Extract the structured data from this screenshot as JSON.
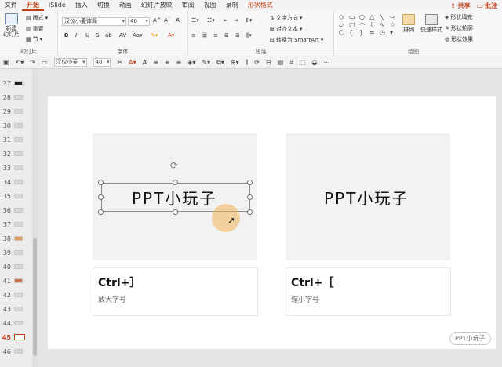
{
  "tabs": [
    "文件",
    "开始",
    "iSlide",
    "插入",
    "切换",
    "动画",
    "幻灯片放映",
    "审阅",
    "视图",
    "录制",
    "形状格式"
  ],
  "active_tab": "开始",
  "share_label": "共享",
  "annotate_label": "批注",
  "ribbon": {
    "slides_group": {
      "new_slide": "新建\n幻灯片",
      "layout": "版式",
      "reset": "重置",
      "section": "节",
      "label": "幻灯片"
    },
    "font_group": {
      "font_name": "汉仪小麦体简",
      "font_size": "40",
      "bold": "B",
      "italic": "I",
      "underline": "U",
      "strike": "S",
      "label": "字体"
    },
    "paragraph_group": {
      "text_direction": "文字方向",
      "align_text": "对齐文本",
      "smartart": "转换为 SmartArt",
      "label": "段落"
    },
    "drawing_group": {
      "arrange": "排列",
      "quick_styles": "快速样式",
      "shape_fill": "形状填充",
      "shape_outline": "形状轮廓",
      "shape_effects": "形状效果",
      "label": "绘图"
    }
  },
  "qat": {
    "font_name": "汉仪小麦",
    "font_size": "40"
  },
  "thumbnails": [
    {
      "num": "27"
    },
    {
      "num": "28"
    },
    {
      "num": "29"
    },
    {
      "num": "30"
    },
    {
      "num": "31"
    },
    {
      "num": "32"
    },
    {
      "num": "33"
    },
    {
      "num": "34"
    },
    {
      "num": "35"
    },
    {
      "num": "36"
    },
    {
      "num": "37"
    },
    {
      "num": "38"
    },
    {
      "num": "39"
    },
    {
      "num": "40"
    },
    {
      "num": "41"
    },
    {
      "num": "42"
    },
    {
      "num": "43"
    },
    {
      "num": "44"
    },
    {
      "num": "45"
    },
    {
      "num": "46"
    }
  ],
  "current_slide": "45",
  "slide": {
    "left_card": {
      "text": "PPT小玩子",
      "title": "Ctrl+］",
      "subtitle": "放大字号"
    },
    "right_card": {
      "text": "PPT小玩子",
      "title": "Ctrl+［",
      "subtitle": "缩小字号"
    },
    "watermark": "PPT小玩子"
  },
  "colors": {
    "accent": "#c43e1c",
    "card_bg": "#f2f2f2",
    "click_highlight": "#f0b45a"
  }
}
